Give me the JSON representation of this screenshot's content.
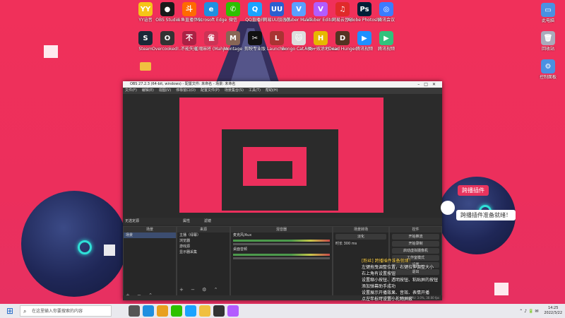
{
  "desktop": {
    "icons_row1": [
      {
        "label": "YY语音",
        "color": "#f5c518",
        "glyph": "YY"
      },
      {
        "label": "OBS Studio",
        "color": "#1a1a1a",
        "glyph": "●"
      },
      {
        "label": "斗鱼直播伴侣",
        "color": "#ff6a00",
        "glyph": "斗"
      },
      {
        "label": "Microsoft Edge",
        "color": "#1f8fe0",
        "glyph": "e"
      },
      {
        "label": "微信",
        "color": "#2dc100",
        "glyph": "✆"
      },
      {
        "label": "QQ直播间",
        "color": "#1aa3ff",
        "glyph": "Q"
      },
      {
        "label": "网易UU加速器",
        "color": "#2a5fd0",
        "glyph": "UU"
      },
      {
        "label": "VTuber Maker",
        "color": "#5aa0ff",
        "glyph": "V"
      },
      {
        "label": "VTuber Editor",
        "color": "#b35cff",
        "glyph": "V"
      },
      {
        "label": "网易云音乐",
        "color": "#e02a2a",
        "glyph": "♫"
      },
      {
        "label": "Adobe Photosho...",
        "color": "#001e36",
        "glyph": "Ps"
      },
      {
        "label": "腾讯会议",
        "color": "#3b7cff",
        "glyph": "◎"
      }
    ],
    "icons_row2": [
      {
        "label": "Steam",
        "color": "#1b2838",
        "glyph": "S"
      },
      {
        "label": "Overcooked!...",
        "color": "#333",
        "glyph": "O"
      },
      {
        "label": "不能失败",
        "color": "#aa2244",
        "glyph": "不"
      },
      {
        "label": "雀魂麻将 (Mahjong...",
        "color": "#cc3355",
        "glyph": "雀"
      },
      {
        "label": "Montage",
        "color": "#886655",
        "glyph": "M"
      },
      {
        "label": "剪映专业版",
        "color": "#111",
        "glyph": "✂"
      },
      {
        "label": "Launcher",
        "color": "#aa3333",
        "glyph": "L"
      },
      {
        "label": "Bongo Cat Mver - 快...",
        "color": "#ddd",
        "glyph": "🐱"
      },
      {
        "label": "人类一败涂地 Human Fa...",
        "color": "#e6b800",
        "glyph": "H"
      },
      {
        "label": "Dead Hunger",
        "color": "#553322",
        "glyph": "D"
      },
      {
        "label": "腾讯视频",
        "color": "#1e90ff",
        "glyph": "▶"
      },
      {
        "label": "腾讯视频",
        "color": "#31c27c",
        "glyph": "▶"
      }
    ],
    "right_icons": [
      {
        "label": "此电脑",
        "color": "#4a90e2",
        "glyph": "▭"
      },
      {
        "label": "回收站",
        "color": "#aab",
        "glyph": "🗑"
      },
      {
        "label": "控制面板",
        "color": "#4a90e2",
        "glyph": "⚙"
      }
    ],
    "folder": {
      "label": "",
      "color": "#f0c040"
    }
  },
  "obs": {
    "title": "OBS 27.2.3 (64-bit, windows) - 配置文件: 未命名 - 场景: 未命名",
    "menu": [
      "文件(F)",
      "编辑(E)",
      "视图(V)",
      "停靠窗口(D)",
      "配置文件(P)",
      "场景集合(S)",
      "工具(T)",
      "帮助(H)"
    ],
    "source_bar": "无选定源",
    "source_bar_right": [
      "属性",
      "滤镜"
    ],
    "docks": {
      "scenes": {
        "header": "场景",
        "items": [
          "场景"
        ]
      },
      "sources": {
        "header": "来源",
        "items": [
          "主播（绿幕）",
          "浏览器",
          "游戏源",
          "显示器采集"
        ]
      },
      "mixer": {
        "header": "混音器",
        "channels": [
          {
            "name": "麦克风/Aux",
            "db": "0.0 dB"
          },
          {
            "name": "桌面音频",
            "db": "0.0 dB"
          }
        ]
      },
      "transitions": {
        "header": "场景转场",
        "mode": "淡化",
        "duration_label": "时长",
        "duration": "300 ms"
      },
      "controls": {
        "header": "控件",
        "buttons": [
          "开始推流",
          "开始录制",
          "启动虚拟摄像机",
          "工作室模式",
          "设置",
          "退出"
        ]
      }
    },
    "status": "LIVE: 00:00:00   REC: 00:00:00   CPU: 3.0%, 30.00 fps"
  },
  "overlay": {
    "plugin_title": "跨播插件",
    "plugin_ready": "跨播插件准备就绪！",
    "chat_lines": [
      "[粉丝] 跨播插件准备就绪！",
      "左键拖曳调整位置，右键拉伸调整大小",
      "右上角有设置按钮",
      "设置缩小按钮、透明按钮、粘贴屏的按钮",
      "添加弹幕助手成功",
      "设置展示开播效果、音效、表情开播",
      "点左半标可设置小礼物屏蔽"
    ]
  },
  "taskbar": {
    "search_placeholder": "在这里输入你要搜索的内容",
    "apps": [
      "#555",
      "#1f8fe0",
      "#e8a020",
      "#2dc100",
      "#1aa3ff",
      "#f0c040",
      "#333",
      "#b35cff"
    ],
    "time": "14:25",
    "date": "2022/3/22"
  }
}
